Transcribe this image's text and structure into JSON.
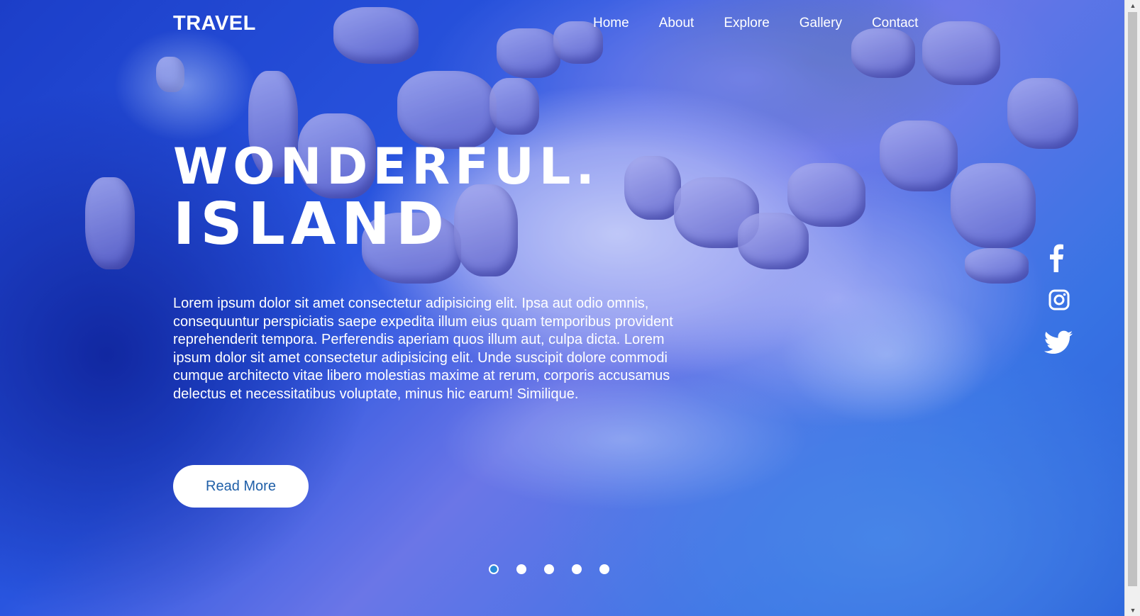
{
  "brand": "TRAVEL",
  "nav": {
    "items": [
      "Home",
      "About",
      "Explore",
      "Gallery",
      "Contact"
    ]
  },
  "hero": {
    "title_line1": "WONDERFUL.",
    "title_line2": "ISLAND",
    "description": "Lorem ipsum dolor sit amet consectetur adipisicing elit. Ipsa aut odio omnis, consequuntur perspiciatis saepe expedita illum eius quam temporibus provident reprehenderit tempora. Perferendis aperiam quos illum aut, culpa dicta. Lorem ipsum dolor sit amet consectetur adipisicing elit. Unde suscipit dolore commodi cumque architecto vitae libero molestias maxime at rerum, corporis accusamus delectus et necessitatibus voluptate, minus hic earum! Similique.",
    "cta_label": "Read More"
  },
  "social": {
    "icons": [
      "facebook-icon",
      "instagram-icon",
      "twitter-icon"
    ],
    "color": "#ffffff"
  },
  "slider": {
    "slide_count": 5,
    "active_index": 0,
    "active_color": "#2a8ad8"
  },
  "colors": {
    "cta_text": "#1f5fa8",
    "overlay": "#2840dc"
  }
}
